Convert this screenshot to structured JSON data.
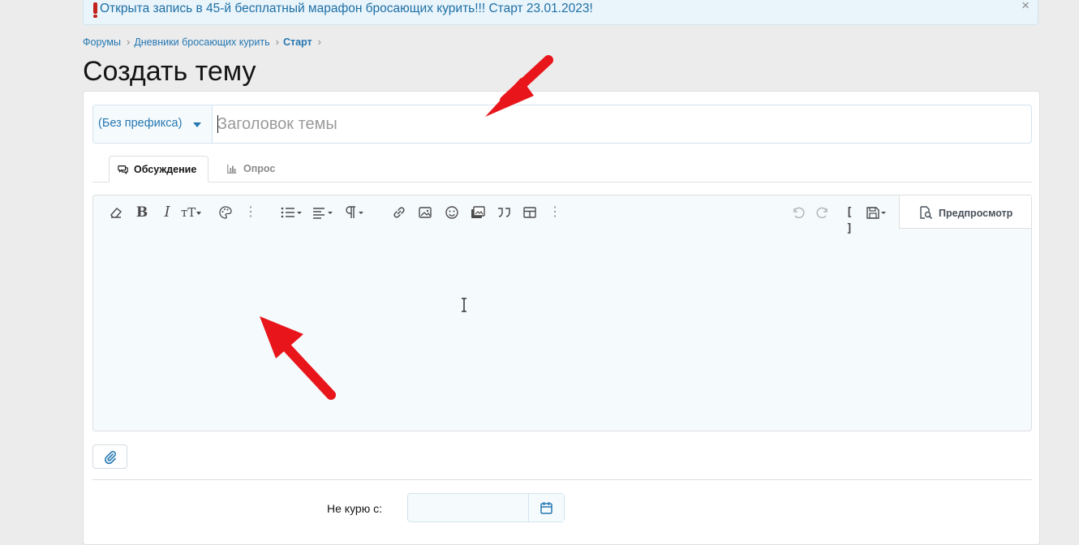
{
  "notice": {
    "text": "Открыта запись в 45-й бесплатный марафон бросающих курить!!! Старт 23.01.2023!",
    "close": "×"
  },
  "breadcrumbs": [
    "Форумы",
    "Дневники бросающих курить",
    "Старт"
  ],
  "page_title": "Создать тему",
  "form": {
    "prefix_label": "(Без префикса)",
    "title_placeholder": "Заголовок темы",
    "title_value": ""
  },
  "tabs": [
    {
      "label": "Обсуждение",
      "active": true,
      "icon": "comments-icon"
    },
    {
      "label": "Опрос",
      "active": false,
      "icon": "bar-chart-icon"
    }
  ],
  "toolbar": {
    "left_icons": [
      "eraser-icon",
      "bold-icon",
      "italic-icon",
      "text-size-icon",
      "palette-icon",
      "more-icon",
      "list-icon",
      "align-icon",
      "paragraph-icon",
      "link-icon",
      "image-icon",
      "smilie-icon",
      "media-icon",
      "quote-icon",
      "table-icon",
      "more-icon"
    ],
    "right_icons": [
      "undo-icon",
      "redo-icon",
      "bbcode-icon",
      "drafts-icon"
    ],
    "bold_glyph": "B",
    "italic_glyph": "I",
    "textsize_glyph": "тТ",
    "bbcode_glyph": "[ ]",
    "preview_label": "Предпросмотр"
  },
  "editor": {
    "content": ""
  },
  "custom_fields": {
    "quit_label": "Не курю с:",
    "quit_value": ""
  },
  "colors": {
    "link": "#2577b1",
    "notice_bg": "#e9f4fb",
    "editor_bg": "#f5fafd",
    "annotation_arrow": "#e8151b"
  }
}
